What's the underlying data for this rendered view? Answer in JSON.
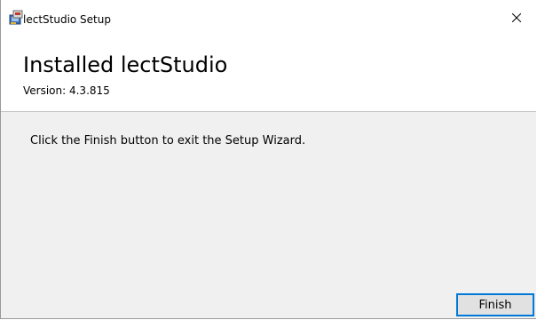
{
  "window": {
    "title": "lectStudio Setup",
    "app_icon": "installer-icon",
    "close_icon": "close-icon"
  },
  "header": {
    "title": "Installed lectStudio",
    "version": "Version: 4.3.815"
  },
  "main": {
    "message": "Click the Finish button to exit the Setup Wizard."
  },
  "buttons": {
    "finish_label": "Finish"
  },
  "colors": {
    "accent": "#0078d7",
    "content_background": "#f0f0f0",
    "header_background": "#ffffff"
  }
}
